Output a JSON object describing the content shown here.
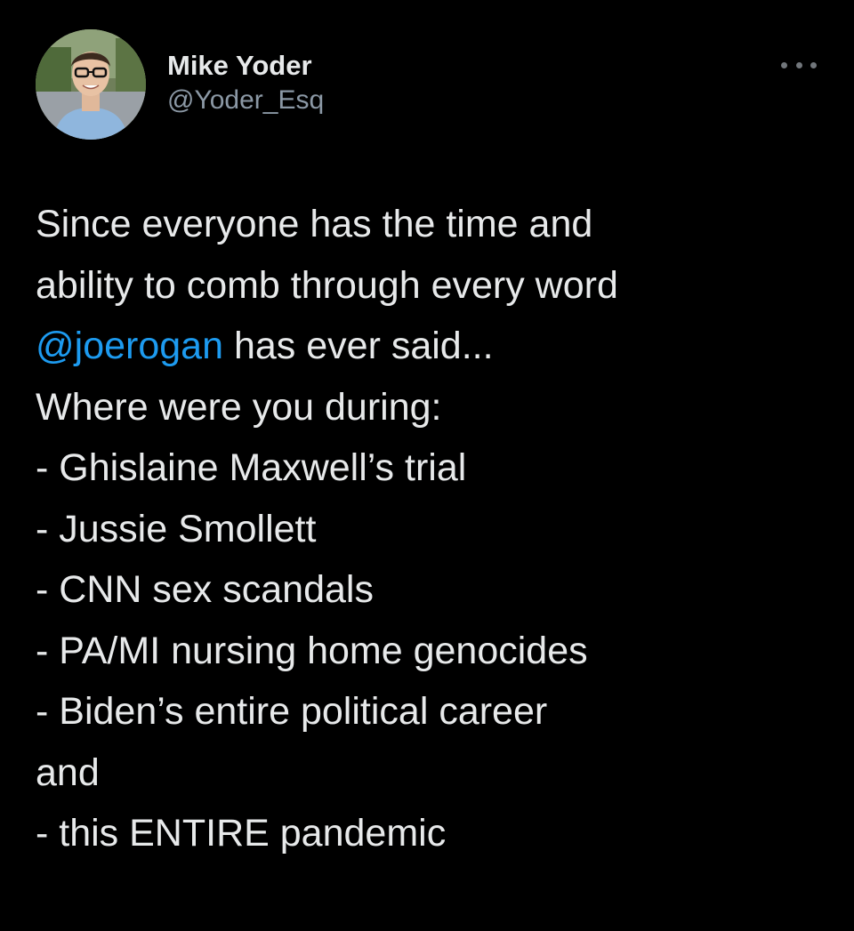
{
  "author": {
    "display_name": "Mike Yoder",
    "handle": "@Yoder_Esq"
  },
  "more_icon": "more-horizontal-icon",
  "tweet": {
    "intro_line_1": "Since everyone has the time and",
    "intro_line_2": "ability to comb through every word",
    "mention": "@joerogan",
    "intro_line_3_rest": " has ever said...",
    "list_heading": "Where were you during:",
    "list_items": [
      "- Ghislaine Maxwell’s trial",
      "- Jussie Smollett",
      "- CNN sex scandals",
      "- PA/MI nursing home genocides",
      "- Biden’s entire political career"
    ],
    "closing_word": "and",
    "closing_item": "- this ENTIRE pandemic"
  },
  "colors": {
    "background": "#000000",
    "text": "#e7e9ea",
    "secondary_text": "#8b98a5",
    "mention": "#1d9bf0"
  }
}
